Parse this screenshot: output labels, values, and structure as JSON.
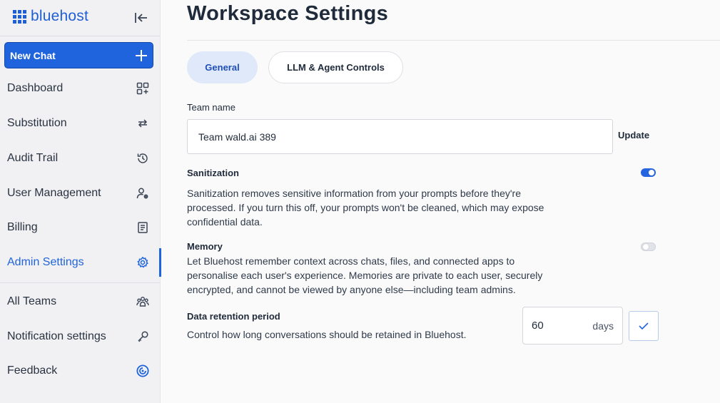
{
  "sidebar": {
    "brand": "bluehost",
    "new_chat_label": "New Chat",
    "items": [
      {
        "label": "Dashboard",
        "icon": "dashboard-icon"
      },
      {
        "label": "Substitution",
        "icon": "swap-icon"
      },
      {
        "label": "Audit Trail",
        "icon": "history-icon"
      },
      {
        "label": "User Management",
        "icon": "user-gear-icon"
      },
      {
        "label": "Billing",
        "icon": "receipt-icon"
      },
      {
        "label": "Admin Settings",
        "icon": "gear-icon",
        "active": true
      },
      {
        "label": "All Teams",
        "icon": "team-icon"
      },
      {
        "label": "Notification settings",
        "icon": "key-icon"
      },
      {
        "label": "Feedback",
        "icon": "feedback-icon"
      }
    ]
  },
  "main": {
    "title": "Workspace Settings",
    "tabs": [
      {
        "label": "General",
        "active": true
      },
      {
        "label": "LLM & Agent Controls",
        "active": false
      }
    ],
    "team_name": {
      "label": "Team name",
      "value": "Team wald.ai 389",
      "update_label": "Update"
    },
    "sanitization": {
      "title": "Sanitization",
      "enabled": true,
      "description_lines": [
        "Sanitization removes sensitive information from your prompts before they're",
        "processed. If you turn this off, your prompts won't be cleaned, which may expose",
        "confidential data."
      ]
    },
    "memory": {
      "title": "Memory",
      "enabled": false,
      "description_lines": [
        "Let Bluehost remember context across chats, files, and connected apps to",
        "personalise each user's experience. Memories are private to each user, securely",
        "encrypted, and cannot be viewed by anyone else—including team admins."
      ]
    },
    "retention": {
      "title": "Data retention period",
      "description": "Control how long conversations should be retained in Bluehost.",
      "value": "60",
      "unit": "days"
    }
  },
  "colors": {
    "accent": "#1f63dd",
    "brand": "#1f5fd6",
    "tab_active_bg": "#dfe9fa"
  }
}
